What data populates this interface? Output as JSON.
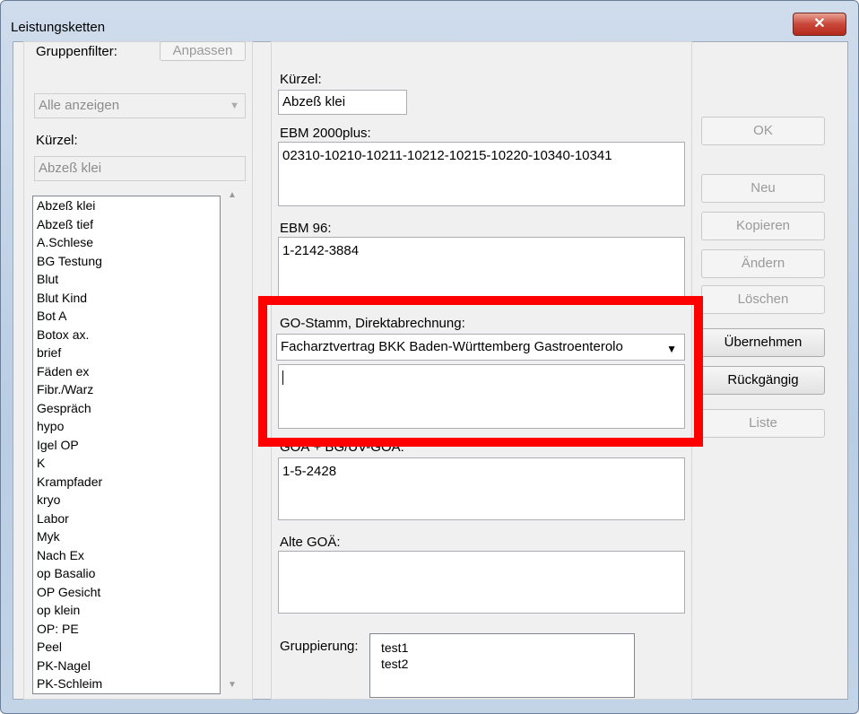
{
  "window": {
    "title": "Leistungsketten",
    "close_label": "x"
  },
  "left": {
    "group_filter_label": "Gruppenfilter:",
    "adjust_button": "Anpassen",
    "group_filter_value": "Alle anzeigen",
    "kuerzel_label": "Kürzel:",
    "kuerzel_value": "Abzeß klei",
    "items": [
      "Abzeß klei",
      "Abzeß tief",
      "A.Schlese",
      "BG Testung",
      "Blut",
      "Blut Kind",
      "Bot A",
      "Botox ax.",
      "brief",
      "Fäden ex",
      "Fibr./Warz",
      "Gespräch",
      "hypo",
      "Igel OP",
      "K",
      "Krampfader",
      "kryo",
      "Labor",
      "Myk",
      "Nach Ex",
      "op Basalio",
      "OP Gesicht",
      "op klein",
      "OP: PE",
      "Peel",
      "PK-Nagel",
      "PK-Schleim"
    ]
  },
  "form": {
    "kuerzel_label": "Kürzel:",
    "kuerzel_value": "Abzeß klei",
    "ebm2000_label": "EBM 2000plus:",
    "ebm2000_value": "02310-10210-10211-10212-10215-10220-10340-10341",
    "ebm96_label": "EBM 96:",
    "ebm96_value": "1-2142-3884",
    "go_label": "GO-Stamm, Direktabrechnung:",
    "go_select_value": "Facharztvertrag BKK Baden-Württemberg Gastroenterolo",
    "go_text_value": "",
    "goae_label": "GOÄ + BG/UV-GOÄ:",
    "goae_value": "1-5-2428",
    "alte_goae_label": "Alte GOÄ:",
    "alte_goae_value": "",
    "gruppierung_label": "Gruppierung:",
    "gruppierung_items": [
      "test1",
      "test2"
    ]
  },
  "buttons": {
    "ok": "OK",
    "neu": "Neu",
    "kopieren": "Kopieren",
    "aendern": "Ändern",
    "loeschen": "Löschen",
    "uebernehmen": "Übernehmen",
    "rueckgaengig": "Rückgängig",
    "liste": "Liste"
  },
  "icons": {
    "dropdown": "chevron-down-icon",
    "close": "close-icon",
    "scroll_up": "scroll-up-icon",
    "scroll_down": "scroll-down-icon"
  }
}
